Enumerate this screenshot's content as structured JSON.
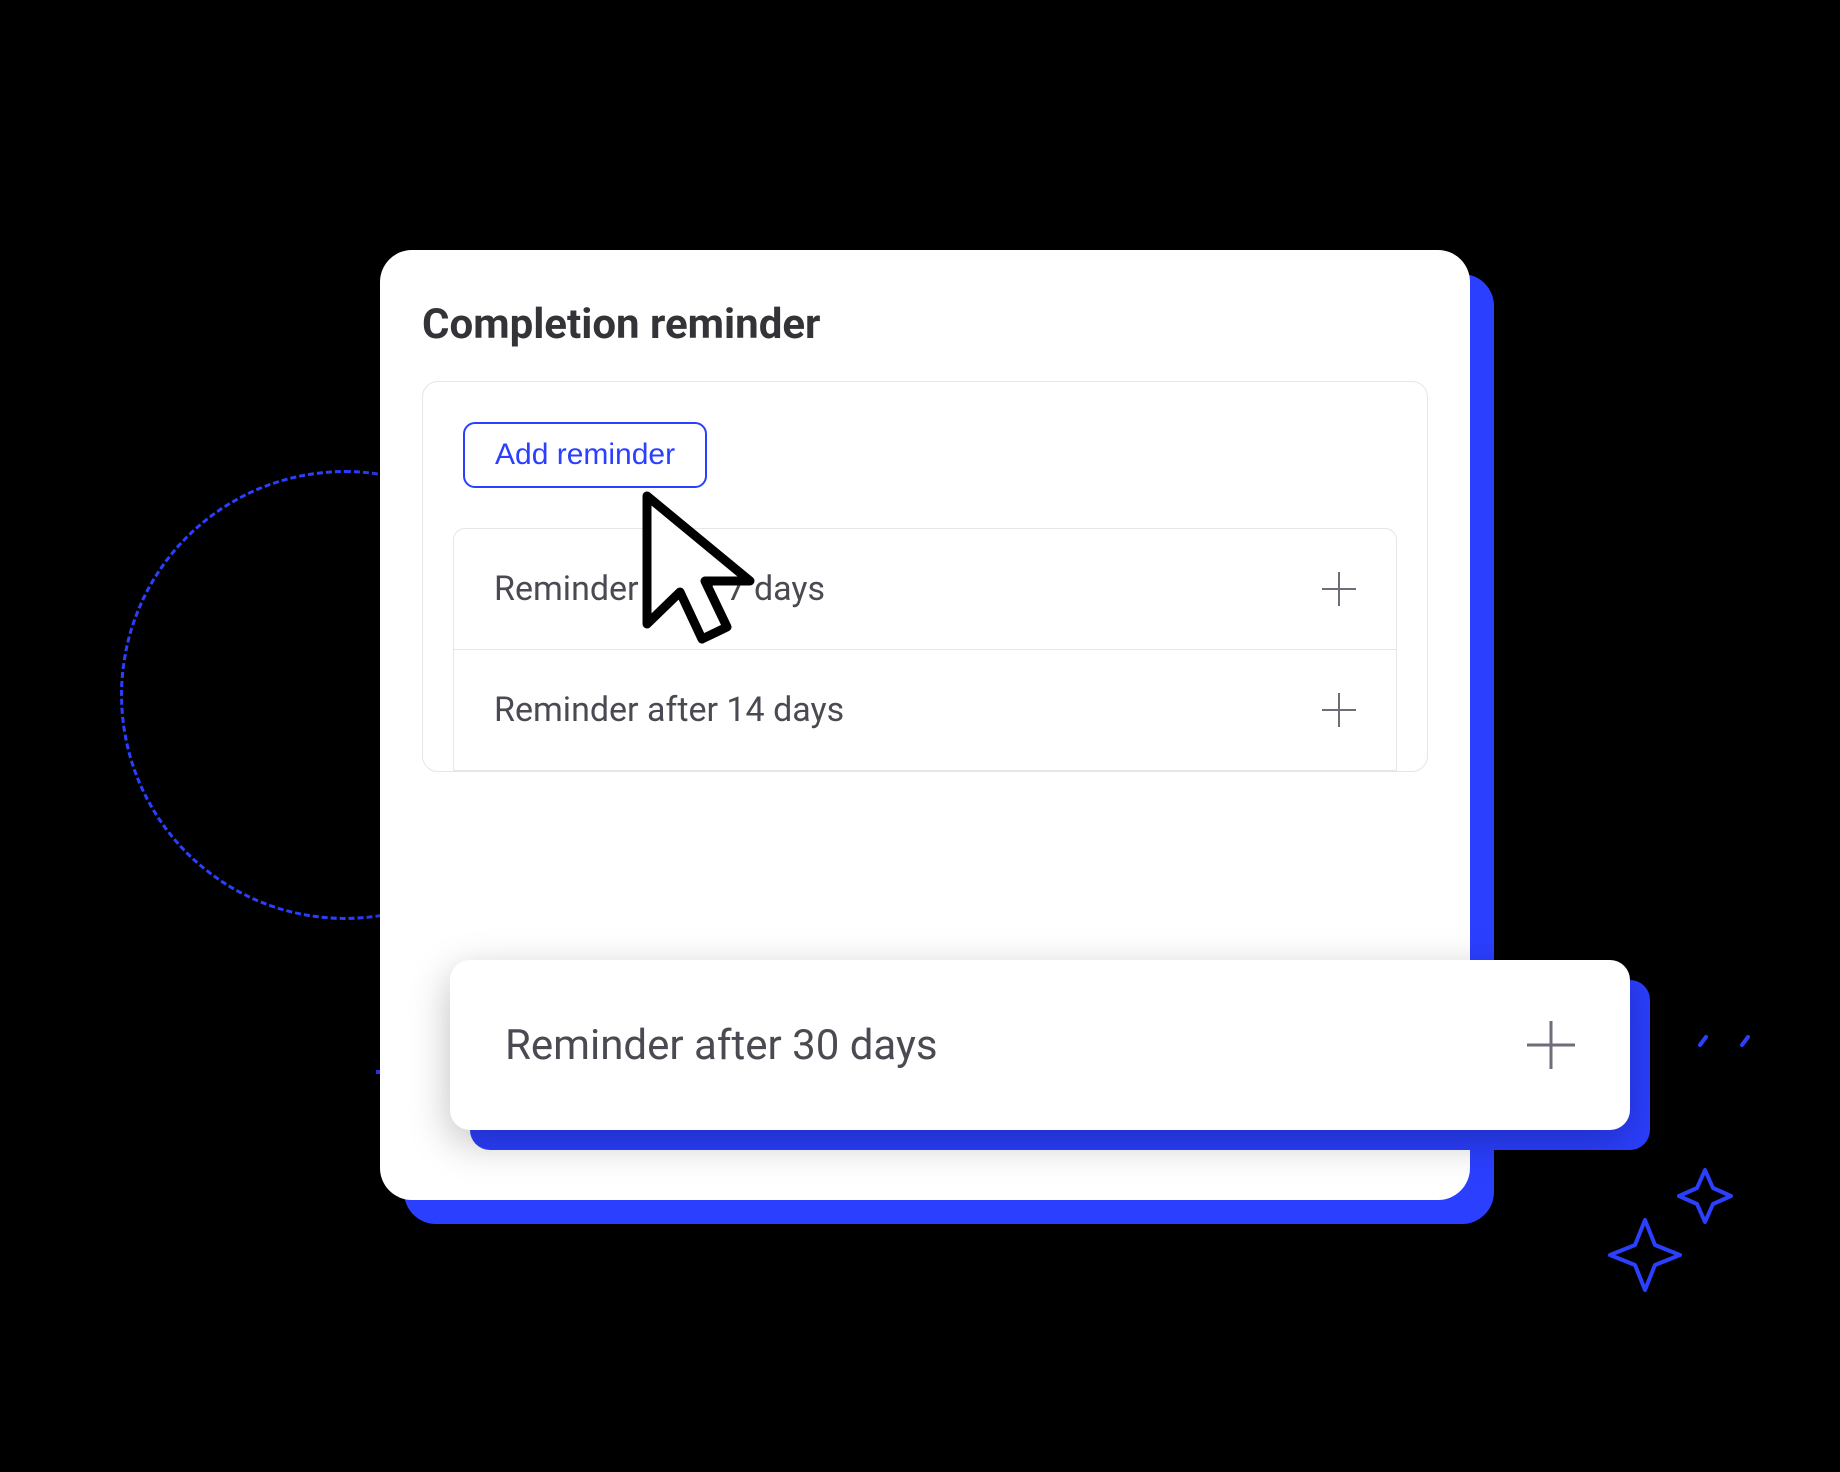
{
  "panel": {
    "title": "Completion reminder",
    "addButton": "Add reminder"
  },
  "reminders": [
    {
      "label": "Reminder after 7 days"
    },
    {
      "label": "Reminder after 14 days"
    }
  ],
  "floatingReminder": {
    "label": "Reminder after 30 days"
  },
  "colors": {
    "accent": "#2B3FFF"
  }
}
